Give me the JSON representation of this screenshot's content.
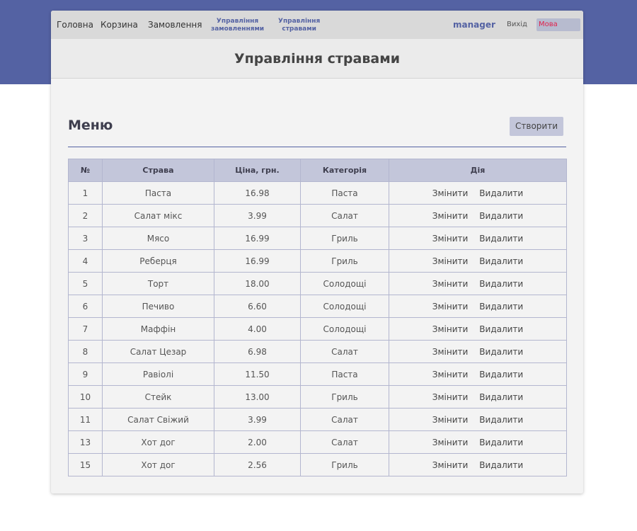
{
  "nav": {
    "home": "Головна",
    "cart": "Корзина",
    "orders": "Замовлення",
    "manage_orders_line1": "Управління",
    "manage_orders_line2": "замовленнями",
    "manage_dishes_line1": "Управління",
    "manage_dishes_line2": "стравами",
    "user": "manager",
    "logout": "Вихід",
    "language": "Мова"
  },
  "page": {
    "title": "Управління стравами",
    "section_title": "Меню",
    "create_button": "Створити"
  },
  "table": {
    "headers": [
      "№",
      "Страва",
      "Ціна, грн.",
      "Категорія",
      "Дія"
    ],
    "edit_label": "Змінити",
    "delete_label": "Видалити",
    "rows": [
      {
        "id": "1",
        "dish": "Паста",
        "price": "16.98",
        "category": "Паста"
      },
      {
        "id": "2",
        "dish": "Салат мікс",
        "price": "3.99",
        "category": "Салат"
      },
      {
        "id": "3",
        "dish": "Мясо",
        "price": "16.99",
        "category": "Гриль"
      },
      {
        "id": "4",
        "dish": "Реберця",
        "price": "16.99",
        "category": "Гриль"
      },
      {
        "id": "5",
        "dish": "Торт",
        "price": "18.00",
        "category": "Солодощі"
      },
      {
        "id": "6",
        "dish": "Печиво",
        "price": "6.60",
        "category": "Солодощі"
      },
      {
        "id": "7",
        "dish": "Маффін",
        "price": "4.00",
        "category": "Солодощі"
      },
      {
        "id": "8",
        "dish": "Салат Цезар",
        "price": "6.98",
        "category": "Салат"
      },
      {
        "id": "9",
        "dish": "Равіолі",
        "price": "11.50",
        "category": "Паста"
      },
      {
        "id": "10",
        "dish": "Стейк",
        "price": "13.00",
        "category": "Гриль"
      },
      {
        "id": "11",
        "dish": "Салат Свіжий",
        "price": "3.99",
        "category": "Салат"
      },
      {
        "id": "13",
        "dish": "Хот дог",
        "price": "2.00",
        "category": "Салат"
      },
      {
        "id": "15",
        "dish": "Хот дог",
        "price": "2.56",
        "category": "Гриль"
      }
    ]
  },
  "colors": {
    "accent": "#5462a3",
    "header_bg": "#c3c6da",
    "language_text": "#e0204b"
  }
}
